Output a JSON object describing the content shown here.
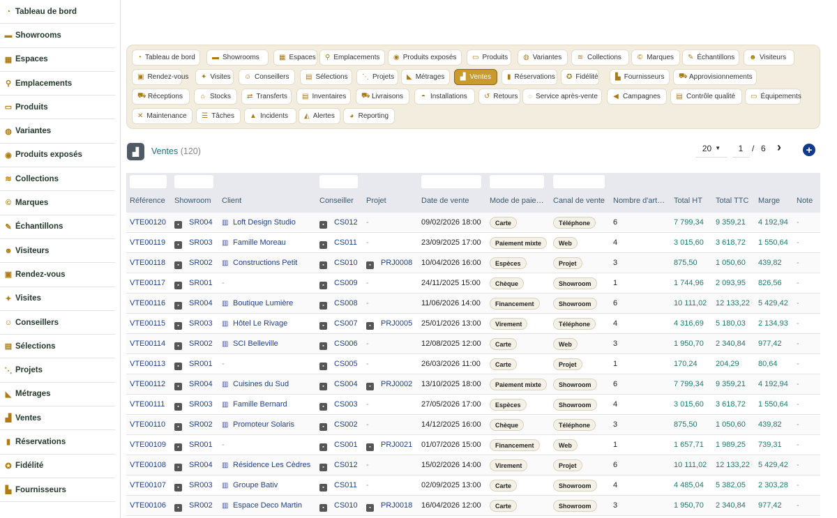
{
  "sidebar": {
    "items": [
      {
        "label": "Tableau de bord",
        "icon": "dashboard-icon",
        "glyph": "◔"
      },
      {
        "label": "Showrooms",
        "icon": "showroom-icon",
        "glyph": "▬"
      },
      {
        "label": "Espaces",
        "icon": "grid-icon",
        "glyph": "▦"
      },
      {
        "label": "Emplacements",
        "icon": "map-pin-icon",
        "glyph": "⚲"
      },
      {
        "label": "Produits",
        "icon": "couch-icon",
        "glyph": "▭"
      },
      {
        "label": "Variantes",
        "icon": "palette-icon",
        "glyph": "◍"
      },
      {
        "label": "Produits exposés",
        "icon": "eye-icon",
        "glyph": "◉"
      },
      {
        "label": "Collections",
        "icon": "layers-icon",
        "glyph": "≋"
      },
      {
        "label": "Marques",
        "icon": "copyright-icon",
        "glyph": "©"
      },
      {
        "label": "Échantillons",
        "icon": "brush-icon",
        "glyph": "✎"
      },
      {
        "label": "Visiteurs",
        "icon": "users-icon",
        "glyph": "☻"
      },
      {
        "label": "Rendez-vous",
        "icon": "calendar-check-icon",
        "glyph": "▣"
      },
      {
        "label": "Visites",
        "icon": "walking-icon",
        "glyph": "✦"
      },
      {
        "label": "Conseillers",
        "icon": "user-tie-icon",
        "glyph": "☺"
      },
      {
        "label": "Sélections",
        "icon": "clipboard-icon",
        "glyph": "▤"
      },
      {
        "label": "Projets",
        "icon": "project-diagram-icon",
        "glyph": "⋱"
      },
      {
        "label": "Métrages",
        "icon": "ruler-icon",
        "glyph": "◣"
      },
      {
        "label": "Ventes",
        "icon": "cash-register-icon",
        "glyph": "▟"
      },
      {
        "label": "Réservations",
        "icon": "bookmark-icon",
        "glyph": "▮"
      },
      {
        "label": "Fidélité",
        "icon": "award-icon",
        "glyph": "✪"
      },
      {
        "label": "Fournisseurs",
        "icon": "industry-icon",
        "glyph": "▙"
      }
    ]
  },
  "modules": {
    "rows": [
      [
        {
          "label": "Tableau de bord",
          "icon": "dashboard-icon",
          "glyph": "◔"
        },
        {
          "label": "Showrooms",
          "icon": "showroom-icon",
          "glyph": "▬"
        },
        {
          "label": "Espaces",
          "icon": "grid-icon",
          "glyph": "▦"
        },
        {
          "label": "Emplacements",
          "icon": "map-pin-icon",
          "glyph": "⚲"
        },
        {
          "label": "Produits exposés",
          "icon": "eye-icon",
          "glyph": "◉"
        },
        {
          "label": "Produits",
          "icon": "couch-icon",
          "glyph": "▭"
        },
        {
          "label": "Variantes",
          "icon": "palette-icon",
          "glyph": "◍"
        },
        {
          "label": "Collections",
          "icon": "layers-icon",
          "glyph": "≋"
        },
        {
          "label": "Marques",
          "icon": "copyright-icon",
          "glyph": "©"
        },
        {
          "label": "Échantillons",
          "icon": "brush-icon",
          "glyph": "✎"
        },
        {
          "label": "Visiteurs",
          "icon": "users-icon",
          "glyph": "☻"
        }
      ],
      [
        {
          "label": "Rendez-vous",
          "icon": "calendar-check-icon",
          "glyph": "▣"
        },
        {
          "label": "Visites",
          "icon": "walking-icon",
          "glyph": "✦"
        },
        {
          "label": "Conseillers",
          "icon": "user-tie-icon",
          "glyph": "☺"
        },
        {
          "label": "Sélections",
          "icon": "clipboard-icon",
          "glyph": "▤"
        },
        {
          "label": "Projets",
          "icon": "project-diagram-icon",
          "glyph": "⋱"
        },
        {
          "label": "Métrages",
          "icon": "ruler-icon",
          "glyph": "◣"
        },
        {
          "label": "Ventes",
          "icon": "cash-register-icon",
          "glyph": "▟",
          "active": true
        },
        {
          "label": "Réservations",
          "icon": "bookmark-icon",
          "glyph": "▮"
        },
        {
          "label": "Fidélité",
          "icon": "award-icon",
          "glyph": "✪"
        },
        {
          "label": "Fournisseurs",
          "icon": "industry-icon",
          "glyph": "▙"
        },
        {
          "label": "Approvisionnements",
          "icon": "dolly-icon",
          "glyph": "⛟"
        }
      ],
      [
        {
          "label": "Réceptions",
          "icon": "truck-loading-icon",
          "glyph": "⛟"
        },
        {
          "label": "Stocks",
          "icon": "warehouse-icon",
          "glyph": "⌂"
        },
        {
          "label": "Transferts",
          "icon": "exchange-icon",
          "glyph": "⇄"
        },
        {
          "label": "Inventaires",
          "icon": "clipboard-check-icon",
          "glyph": "▤"
        },
        {
          "label": "Livraisons",
          "icon": "truck-icon",
          "glyph": "⛟"
        },
        {
          "label": "Installations",
          "icon": "hard-hat-icon",
          "glyph": "◓"
        },
        {
          "label": "Retours",
          "icon": "undo-icon",
          "glyph": "↺"
        },
        {
          "label": "Service après-vente",
          "icon": "comment-icon",
          "glyph": "◌"
        },
        {
          "label": "Campagnes",
          "icon": "bullhorn-icon",
          "glyph": "◀"
        },
        {
          "label": "Contrôle qualité",
          "icon": "clipboard-list-icon",
          "glyph": "▤"
        },
        {
          "label": "Équipements",
          "icon": "desktop-icon",
          "glyph": "▭"
        }
      ],
      [
        {
          "label": "Maintenance",
          "icon": "tools-icon",
          "glyph": "✕"
        },
        {
          "label": "Tâches",
          "icon": "tasks-icon",
          "glyph": "☰"
        },
        {
          "label": "Incidents",
          "icon": "warning-icon",
          "glyph": "▲"
        },
        {
          "label": "Alertes",
          "icon": "bell-icon",
          "glyph": "◭"
        },
        {
          "label": "Reporting",
          "icon": "chart-pie-icon",
          "glyph": "◕"
        }
      ]
    ]
  },
  "header": {
    "title": "Ventes",
    "count": "(120)",
    "icon": "cash-register-icon"
  },
  "pager": {
    "page_size": "20",
    "current_page": "1",
    "separator": "/",
    "total_pages": "6",
    "next_icon": "chevron-right-icon",
    "add_icon": "plus-circle-icon"
  },
  "table": {
    "columns": [
      "Référence",
      "Showroom",
      "Client",
      "Conseiller",
      "Projet",
      "Date de vente",
      "Mode de paie…",
      "Canal de vente",
      "Nombre d'art…",
      "Total HT",
      "Total TTC",
      "Marge",
      "Note"
    ],
    "rows": [
      {
        "ref": "VTE00120",
        "showroom": "SR004",
        "client": "Loft Design Studio",
        "conseiller": "CS012",
        "projet": "-",
        "date": "09/02/2026 18:00",
        "mode": "Carte",
        "canal": "Téléphone",
        "nb": "6",
        "ht": "7 799,34",
        "ttc": "9 359,21",
        "marge": "4 192,94",
        "note": "-"
      },
      {
        "ref": "VTE00119",
        "showroom": "SR003",
        "client": "Famille Moreau",
        "conseiller": "CS011",
        "projet": "-",
        "date": "23/09/2025 17:00",
        "mode": "Paiement mixte",
        "canal": "Web",
        "nb": "4",
        "ht": "3 015,60",
        "ttc": "3 618,72",
        "marge": "1 550,64",
        "note": "-"
      },
      {
        "ref": "VTE00118",
        "showroom": "SR002",
        "client": "Constructions Petit",
        "conseiller": "CS010",
        "projet": "PRJ0008",
        "date": "10/04/2026 16:00",
        "mode": "Espèces",
        "canal": "Projet",
        "nb": "3",
        "ht": "875,50",
        "ttc": "1 050,60",
        "marge": "439,82",
        "note": "-"
      },
      {
        "ref": "VTE00117",
        "showroom": "SR001",
        "client": "-",
        "conseiller": "CS009",
        "projet": "-",
        "date": "24/11/2025 15:00",
        "mode": "Chèque",
        "canal": "Showroom",
        "nb": "1",
        "ht": "1 744,96",
        "ttc": "2 093,95",
        "marge": "826,56",
        "note": "-"
      },
      {
        "ref": "VTE00116",
        "showroom": "SR004",
        "client": "Boutique Lumière",
        "conseiller": "CS008",
        "projet": "-",
        "date": "11/06/2026 14:00",
        "mode": "Financement",
        "canal": "Showroom",
        "nb": "6",
        "ht": "10 111,02",
        "ttc": "12 133,22",
        "marge": "5 429,42",
        "note": "-"
      },
      {
        "ref": "VTE00115",
        "showroom": "SR003",
        "client": "Hôtel Le Rivage",
        "conseiller": "CS007",
        "projet": "PRJ0005",
        "date": "25/01/2026 13:00",
        "mode": "Virement",
        "canal": "Téléphone",
        "nb": "4",
        "ht": "4 316,69",
        "ttc": "5 180,03",
        "marge": "2 134,93",
        "note": "-"
      },
      {
        "ref": "VTE00114",
        "showroom": "SR002",
        "client": "SCI Belleville",
        "conseiller": "CS006",
        "projet": "-",
        "date": "12/08/2025 12:00",
        "mode": "Carte",
        "canal": "Web",
        "nb": "3",
        "ht": "1 950,70",
        "ttc": "2 340,84",
        "marge": "977,42",
        "note": "-"
      },
      {
        "ref": "VTE00113",
        "showroom": "SR001",
        "client": "-",
        "conseiller": "CS005",
        "projet": "-",
        "date": "26/03/2026 11:00",
        "mode": "Carte",
        "canal": "Projet",
        "nb": "1",
        "ht": "170,24",
        "ttc": "204,29",
        "marge": "80,64",
        "note": "-"
      },
      {
        "ref": "VTE00112",
        "showroom": "SR004",
        "client": "Cuisines du Sud",
        "conseiller": "CS004",
        "projet": "PRJ0002",
        "date": "13/10/2025 18:00",
        "mode": "Paiement mixte",
        "canal": "Showroom",
        "nb": "6",
        "ht": "7 799,34",
        "ttc": "9 359,21",
        "marge": "4 192,94",
        "note": "-"
      },
      {
        "ref": "VTE00111",
        "showroom": "SR003",
        "client": "Famille Bernard",
        "conseiller": "CS003",
        "projet": "-",
        "date": "27/05/2026 17:00",
        "mode": "Espèces",
        "canal": "Showroom",
        "nb": "4",
        "ht": "3 015,60",
        "ttc": "3 618,72",
        "marge": "1 550,64",
        "note": "-"
      },
      {
        "ref": "VTE00110",
        "showroom": "SR002",
        "client": "Promoteur Solaris",
        "conseiller": "CS002",
        "projet": "-",
        "date": "14/12/2025 16:00",
        "mode": "Chèque",
        "canal": "Téléphone",
        "nb": "3",
        "ht": "875,50",
        "ttc": "1 050,60",
        "marge": "439,82",
        "note": "-"
      },
      {
        "ref": "VTE00109",
        "showroom": "SR001",
        "client": "-",
        "conseiller": "CS001",
        "projet": "PRJ0021",
        "date": "01/07/2026 15:00",
        "mode": "Financement",
        "canal": "Web",
        "nb": "1",
        "ht": "1 657,71",
        "ttc": "1 989,25",
        "marge": "739,31",
        "note": "-"
      },
      {
        "ref": "VTE00108",
        "showroom": "SR004",
        "client": "Résidence Les Cèdres",
        "conseiller": "CS012",
        "projet": "-",
        "date": "15/02/2026 14:00",
        "mode": "Virement",
        "canal": "Projet",
        "nb": "6",
        "ht": "10 111,02",
        "ttc": "12 133,22",
        "marge": "5 429,42",
        "note": "-"
      },
      {
        "ref": "VTE00107",
        "showroom": "SR003",
        "client": "Groupe Bativ",
        "conseiller": "CS011",
        "projet": "-",
        "date": "02/09/2025 13:00",
        "mode": "Carte",
        "canal": "Showroom",
        "nb": "4",
        "ht": "4 485,04",
        "ttc": "5 382,05",
        "marge": "2 303,28",
        "note": "-"
      },
      {
        "ref": "VTE00106",
        "showroom": "SR002",
        "client": "Espace Deco Martin",
        "conseiller": "CS010",
        "projet": "PRJ0018",
        "date": "16/04/2026 12:00",
        "mode": "Carte",
        "canal": "Showroom",
        "nb": "3",
        "ht": "1 950,70",
        "ttc": "2 340,84",
        "marge": "977,42",
        "note": "-"
      }
    ]
  },
  "colors": {
    "accent": "#c99a2e",
    "link": "#1f3f8a",
    "money": "#1e7a6a",
    "panel": "#f3eddf"
  }
}
